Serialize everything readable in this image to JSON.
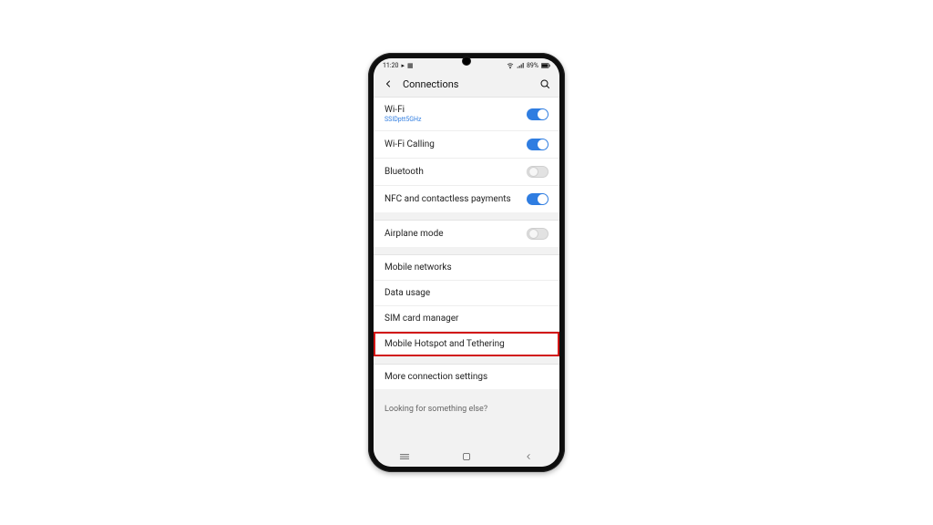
{
  "status": {
    "time": "11:20",
    "battery": "89%"
  },
  "appbar": {
    "title": "Connections"
  },
  "rows": {
    "wifi": {
      "label": "Wi-Fi",
      "sub": "SSIDptt5GHz"
    },
    "wificall": {
      "label": "Wi-Fi Calling"
    },
    "bluetooth": {
      "label": "Bluetooth"
    },
    "nfc": {
      "label": "NFC and contactless payments"
    },
    "airplane": {
      "label": "Airplane mode"
    },
    "mobile": {
      "label": "Mobile networks"
    },
    "data": {
      "label": "Data usage"
    },
    "sim": {
      "label": "SIM card manager"
    },
    "hotspot": {
      "label": "Mobile Hotspot and Tethering"
    },
    "more": {
      "label": "More connection settings"
    },
    "footer": {
      "label": "Looking for something else?"
    }
  }
}
